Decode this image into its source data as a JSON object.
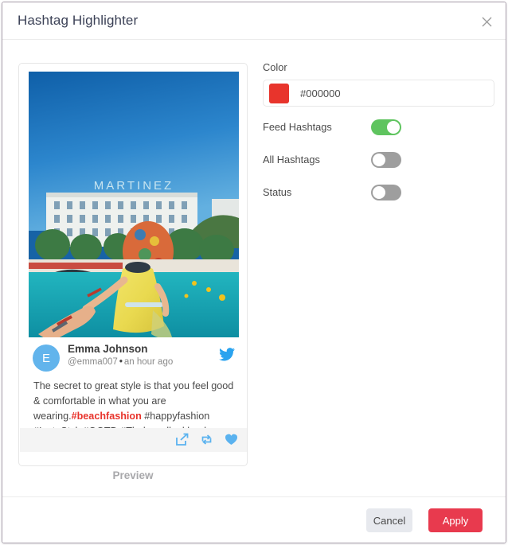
{
  "dialog": {
    "title": "Hashtag Highlighter",
    "close_icon": "close-icon"
  },
  "settings": {
    "color_label": "Color",
    "color_value": "#000000",
    "color_placeholder": "#000000",
    "swatch_color": "#e8342c",
    "toggles": [
      {
        "label": "Feed Hashtags",
        "state": "on"
      },
      {
        "label": "All Hashtags",
        "state": "off"
      },
      {
        "label": "Status",
        "state": "off"
      }
    ]
  },
  "preview": {
    "caption": "Preview",
    "tweet": {
      "avatar_initial": "E",
      "author": "Emma Johnson",
      "handle": "@emma007",
      "separator": "•",
      "timestamp": "an hour ago",
      "text_before": "The secret to great style is that you feel good & comfortable in what you are wearing.",
      "highlighted_hashtag": "#beachfashion",
      "text_after": " #happyfashion #InstaStyle#OOTD #Thebrandlookbook",
      "network_icon": "twitter-bird-icon",
      "actions": [
        {
          "icon": "share-icon"
        },
        {
          "icon": "retweet-icon"
        },
        {
          "icon": "heart-icon"
        }
      ],
      "photo_alt": "MARTINEZ"
    }
  },
  "footer": {
    "cancel_label": "Cancel",
    "apply_label": "Apply"
  },
  "colors": {
    "accent_red": "#e8342c",
    "apply_red": "#e83a4e",
    "toggle_on_green": "#5fc45f",
    "toggle_off_gray": "#9e9e9e",
    "twitter_blue": "#2aa3ef"
  }
}
